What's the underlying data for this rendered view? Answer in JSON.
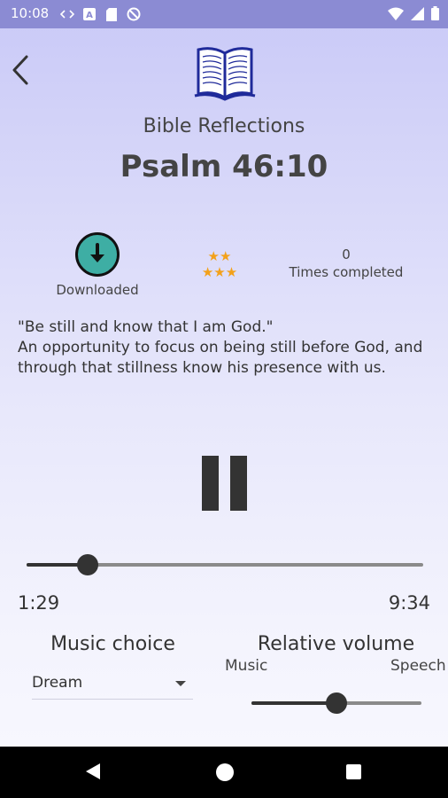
{
  "status_bar": {
    "time": "10:08",
    "left_icons": [
      "code-icon",
      "font-a-icon",
      "sd-card-icon",
      "no-sign-icon"
    ],
    "right_icons": [
      "wifi-icon",
      "signal-icon",
      "battery-icon"
    ]
  },
  "header": {
    "app_title": "Bible Reflections",
    "verse_title": "Psalm 46:10",
    "accent_color": "#1f2a9a"
  },
  "stats": {
    "download_label": "Downloaded",
    "download_color": "#3eaea4",
    "stars_top": "★★",
    "stars_bottom": "★★★",
    "star_color": "#f3a11a",
    "times_completed": "0",
    "times_completed_label": "Times completed"
  },
  "description": {
    "line1": "\"Be still and know that I am God.\"",
    "line2": "An opportunity to focus on being still before God, and",
    "line3": "through that stillness know his presence with us."
  },
  "player": {
    "elapsed": "1:29",
    "total": "9:34",
    "progress_fraction": 0.155
  },
  "music": {
    "label": "Music choice",
    "selected": "Dream"
  },
  "volume": {
    "label": "Relative volume",
    "left_label": "Music",
    "right_label": "Speech",
    "level_fraction": 0.5
  },
  "nav": {
    "icons": [
      "back-triangle-icon",
      "home-circle-icon",
      "recents-square-icon"
    ]
  }
}
